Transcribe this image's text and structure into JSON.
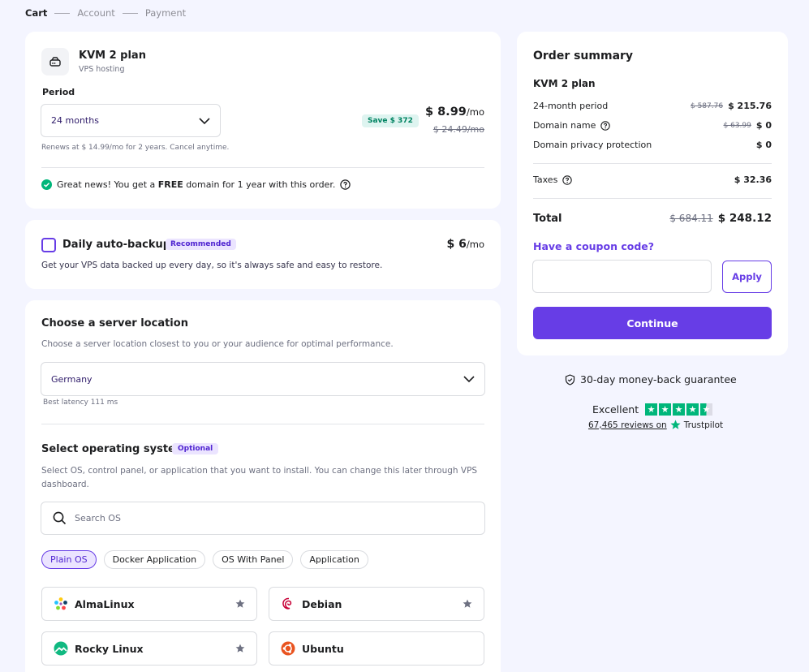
{
  "steps": [
    "Cart",
    "Account",
    "Payment"
  ],
  "plan": {
    "title": "KVM 2 plan",
    "subtitle": "VPS hosting",
    "period_label": "Period",
    "period_value": "24 months",
    "renew_text": "Renews at $ 14.99/mo for 2 years. Cancel anytime.",
    "save_badge": "Save $ 372",
    "price": "$ 8.99",
    "per": "/mo",
    "old_price": "$ 24.49/mo",
    "news_prefix": "Great news! You get a ",
    "news_bold": "FREE",
    "news_suffix": " domain for 1 year with this order."
  },
  "backup": {
    "title": "Daily auto-backup",
    "badge": "Recommended",
    "price": "$ 6",
    "per": "/mo",
    "description": "Get your VPS data backed up every day, so it's always safe and easy to restore."
  },
  "location": {
    "title": "Choose a server location",
    "description": "Choose a server location closest to you or your audience for optimal performance.",
    "selected": "Germany",
    "latency": "Best latency 111 ms"
  },
  "os": {
    "title": "Select operating system",
    "badge": "Optional",
    "description": "Select OS, control panel, or application that you want to install. You can change this later through VPS dashboard.",
    "search_placeholder": "Search OS",
    "tabs": [
      "Plain OS",
      "Docker Application",
      "OS With Panel",
      "Application"
    ],
    "items": [
      "AlmaLinux",
      "Debian",
      "Rocky Linux",
      "Ubuntu"
    ]
  },
  "summary": {
    "title": "Order summary",
    "plan": "KVM 2 plan",
    "rows": [
      {
        "label": "24-month period",
        "old": "$ 587.76",
        "value": "$ 215.76"
      },
      {
        "label": "Domain name",
        "old": "$ 63.99",
        "value": "$ 0"
      },
      {
        "label": "Domain privacy protection",
        "value": "$ 0"
      }
    ],
    "taxes_label": "Taxes",
    "taxes_value": "$ 32.36",
    "total_label": "Total",
    "total_old": "$ 684.11",
    "total_value": "$ 248.12",
    "coupon_label": "Have a coupon code?",
    "apply_label": "Apply",
    "continue_label": "Continue"
  },
  "trust": {
    "guarantee": "30-day money-back guarantee",
    "rating": "Excellent",
    "reviews": "67,465 reviews on",
    "brand": "Trustpilot"
  },
  "colors": {
    "accent": "#673de6",
    "success": "#00b67a",
    "background": "#f4f5ff"
  }
}
